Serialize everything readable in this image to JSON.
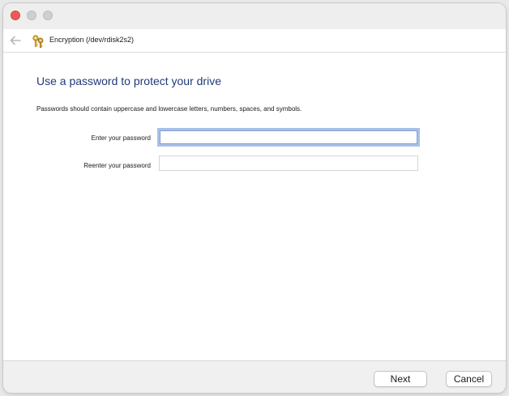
{
  "window": {
    "controls": [
      "close",
      "minimize",
      "maximize"
    ]
  },
  "nav": {
    "back_icon": "back-arrow-icon",
    "app_icon": "keys-icon",
    "title": "Encryption (/dev/rdisk2s2)"
  },
  "main": {
    "title": "Use a password to protect your drive",
    "hint": "Passwords should contain uppercase and lowercase letters, numbers, spaces, and symbols.",
    "fields": [
      {
        "label": "Enter your password",
        "value": "",
        "placeholder": ""
      },
      {
        "label": "Reenter your password",
        "value": "",
        "placeholder": ""
      }
    ]
  },
  "footer": {
    "next_label": "Next",
    "cancel_label": "Cancel"
  },
  "colors": {
    "title": "#1f3a7a",
    "close": "#ed5c54",
    "focus_ring": "#a9c1e6"
  }
}
